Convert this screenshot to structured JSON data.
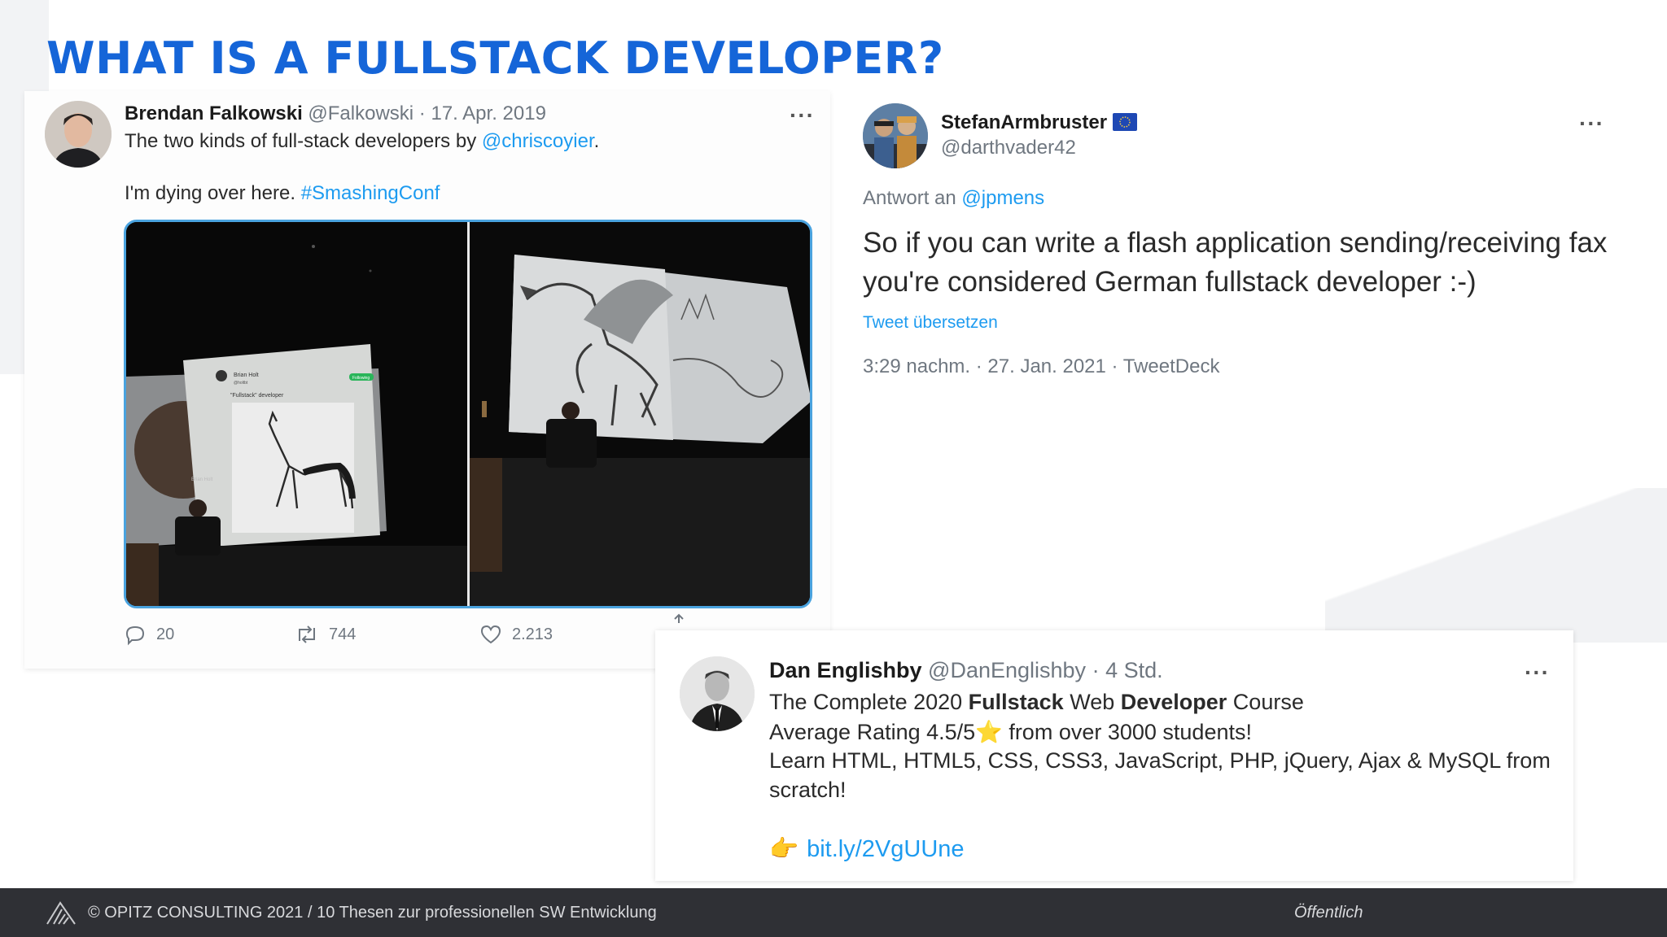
{
  "slide": {
    "title": "WHAT IS A FULLSTACK DEVELOPER?",
    "accent_color": "#1565d8"
  },
  "tweet1": {
    "author_name": "Brendan Falkowski",
    "handle": "@Falkowski",
    "separator": "·",
    "date": "17. Apr. 2019",
    "more": "···",
    "text_prefix": "The two kinds of full-stack developers by ",
    "mention": "@chriscoyier",
    "text_suffix": ".",
    "line2_text": "I'm dying over here. ",
    "hashtag": "#SmashingConf",
    "media": {
      "left_slide_name": "Brian Holt",
      "left_slide_handle": "@holtbt",
      "left_slide_button": "Following",
      "left_slide_caption": "\"Fullstack\" developer",
      "left_side_label": "Brian Holt"
    },
    "actions": {
      "reply_icon": "reply-icon",
      "reply_count": "20",
      "retweet_icon": "retweet-icon",
      "retweet_count": "744",
      "like_icon": "heart-icon",
      "like_count": "2.213",
      "share_icon": "share-icon"
    }
  },
  "tweet2": {
    "author_name": "StefanArmbruster",
    "flag": "eu-flag-icon",
    "handle": "@darthvader42",
    "more": "···",
    "reply_prefix": "Antwort an ",
    "reply_to": "@jpmens",
    "body": "So if you can write a flash application sending/receiving fax you're considered German fullstack developer :-)",
    "translate": "Tweet übersetzen",
    "meta": "3:29 nachm. · 27. Jan. 2021 · TweetDeck"
  },
  "tweet3": {
    "author_name": "Dan Englishby",
    "handle": "@DanEnglishby",
    "separator": "·",
    "time": "4 Std.",
    "more": "···",
    "line1_a": "The Complete 2020 ",
    "line1_b": "Fullstack",
    "line1_c": " Web ",
    "line1_d": "Developer",
    "line1_e": " Course",
    "line2_a": "Average Rating 4.5/5",
    "line2_star": "⭐",
    "line2_b": " from over 3000 students!",
    "line3": "Learn HTML, HTML5, CSS, CSS3, JavaScript, PHP, jQuery, Ajax & MySQL from",
    "line4": "scratch!",
    "link_emoji": "👉",
    "link": "bit.ly/2VgUUne"
  },
  "footer": {
    "copyright": "© OPITZ CONSULTING 2021   /   10 Thesen zur professionellen SW Entwicklung",
    "classification": "Öffentlich",
    "logo": "opitz-logo-icon"
  }
}
